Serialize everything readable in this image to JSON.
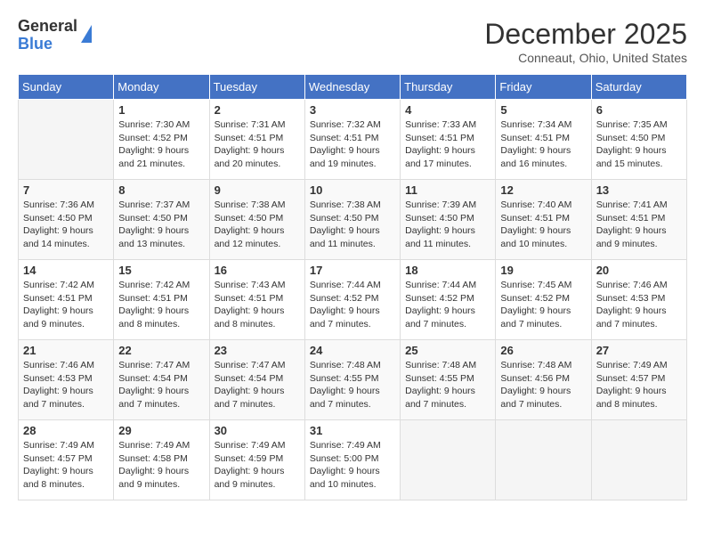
{
  "logo": {
    "general": "General",
    "blue": "Blue"
  },
  "title": "December 2025",
  "location": "Conneaut, Ohio, United States",
  "days_of_week": [
    "Sunday",
    "Monday",
    "Tuesday",
    "Wednesday",
    "Thursday",
    "Friday",
    "Saturday"
  ],
  "weeks": [
    [
      {
        "day": "",
        "info": ""
      },
      {
        "day": "1",
        "info": "Sunrise: 7:30 AM\nSunset: 4:52 PM\nDaylight: 9 hours\nand 21 minutes."
      },
      {
        "day": "2",
        "info": "Sunrise: 7:31 AM\nSunset: 4:51 PM\nDaylight: 9 hours\nand 20 minutes."
      },
      {
        "day": "3",
        "info": "Sunrise: 7:32 AM\nSunset: 4:51 PM\nDaylight: 9 hours\nand 19 minutes."
      },
      {
        "day": "4",
        "info": "Sunrise: 7:33 AM\nSunset: 4:51 PM\nDaylight: 9 hours\nand 17 minutes."
      },
      {
        "day": "5",
        "info": "Sunrise: 7:34 AM\nSunset: 4:51 PM\nDaylight: 9 hours\nand 16 minutes."
      },
      {
        "day": "6",
        "info": "Sunrise: 7:35 AM\nSunset: 4:50 PM\nDaylight: 9 hours\nand 15 minutes."
      }
    ],
    [
      {
        "day": "7",
        "info": "Sunrise: 7:36 AM\nSunset: 4:50 PM\nDaylight: 9 hours\nand 14 minutes."
      },
      {
        "day": "8",
        "info": "Sunrise: 7:37 AM\nSunset: 4:50 PM\nDaylight: 9 hours\nand 13 minutes."
      },
      {
        "day": "9",
        "info": "Sunrise: 7:38 AM\nSunset: 4:50 PM\nDaylight: 9 hours\nand 12 minutes."
      },
      {
        "day": "10",
        "info": "Sunrise: 7:38 AM\nSunset: 4:50 PM\nDaylight: 9 hours\nand 11 minutes."
      },
      {
        "day": "11",
        "info": "Sunrise: 7:39 AM\nSunset: 4:50 PM\nDaylight: 9 hours\nand 11 minutes."
      },
      {
        "day": "12",
        "info": "Sunrise: 7:40 AM\nSunset: 4:51 PM\nDaylight: 9 hours\nand 10 minutes."
      },
      {
        "day": "13",
        "info": "Sunrise: 7:41 AM\nSunset: 4:51 PM\nDaylight: 9 hours\nand 9 minutes."
      }
    ],
    [
      {
        "day": "14",
        "info": "Sunrise: 7:42 AM\nSunset: 4:51 PM\nDaylight: 9 hours\nand 9 minutes."
      },
      {
        "day": "15",
        "info": "Sunrise: 7:42 AM\nSunset: 4:51 PM\nDaylight: 9 hours\nand 8 minutes."
      },
      {
        "day": "16",
        "info": "Sunrise: 7:43 AM\nSunset: 4:51 PM\nDaylight: 9 hours\nand 8 minutes."
      },
      {
        "day": "17",
        "info": "Sunrise: 7:44 AM\nSunset: 4:52 PM\nDaylight: 9 hours\nand 7 minutes."
      },
      {
        "day": "18",
        "info": "Sunrise: 7:44 AM\nSunset: 4:52 PM\nDaylight: 9 hours\nand 7 minutes."
      },
      {
        "day": "19",
        "info": "Sunrise: 7:45 AM\nSunset: 4:52 PM\nDaylight: 9 hours\nand 7 minutes."
      },
      {
        "day": "20",
        "info": "Sunrise: 7:46 AM\nSunset: 4:53 PM\nDaylight: 9 hours\nand 7 minutes."
      }
    ],
    [
      {
        "day": "21",
        "info": "Sunrise: 7:46 AM\nSunset: 4:53 PM\nDaylight: 9 hours\nand 7 minutes."
      },
      {
        "day": "22",
        "info": "Sunrise: 7:47 AM\nSunset: 4:54 PM\nDaylight: 9 hours\nand 7 minutes."
      },
      {
        "day": "23",
        "info": "Sunrise: 7:47 AM\nSunset: 4:54 PM\nDaylight: 9 hours\nand 7 minutes."
      },
      {
        "day": "24",
        "info": "Sunrise: 7:48 AM\nSunset: 4:55 PM\nDaylight: 9 hours\nand 7 minutes."
      },
      {
        "day": "25",
        "info": "Sunrise: 7:48 AM\nSunset: 4:55 PM\nDaylight: 9 hours\nand 7 minutes."
      },
      {
        "day": "26",
        "info": "Sunrise: 7:48 AM\nSunset: 4:56 PM\nDaylight: 9 hours\nand 7 minutes."
      },
      {
        "day": "27",
        "info": "Sunrise: 7:49 AM\nSunset: 4:57 PM\nDaylight: 9 hours\nand 8 minutes."
      }
    ],
    [
      {
        "day": "28",
        "info": "Sunrise: 7:49 AM\nSunset: 4:57 PM\nDaylight: 9 hours\nand 8 minutes."
      },
      {
        "day": "29",
        "info": "Sunrise: 7:49 AM\nSunset: 4:58 PM\nDaylight: 9 hours\nand 9 minutes."
      },
      {
        "day": "30",
        "info": "Sunrise: 7:49 AM\nSunset: 4:59 PM\nDaylight: 9 hours\nand 9 minutes."
      },
      {
        "day": "31",
        "info": "Sunrise: 7:49 AM\nSunset: 5:00 PM\nDaylight: 9 hours\nand 10 minutes."
      },
      {
        "day": "",
        "info": ""
      },
      {
        "day": "",
        "info": ""
      },
      {
        "day": "",
        "info": ""
      }
    ]
  ]
}
